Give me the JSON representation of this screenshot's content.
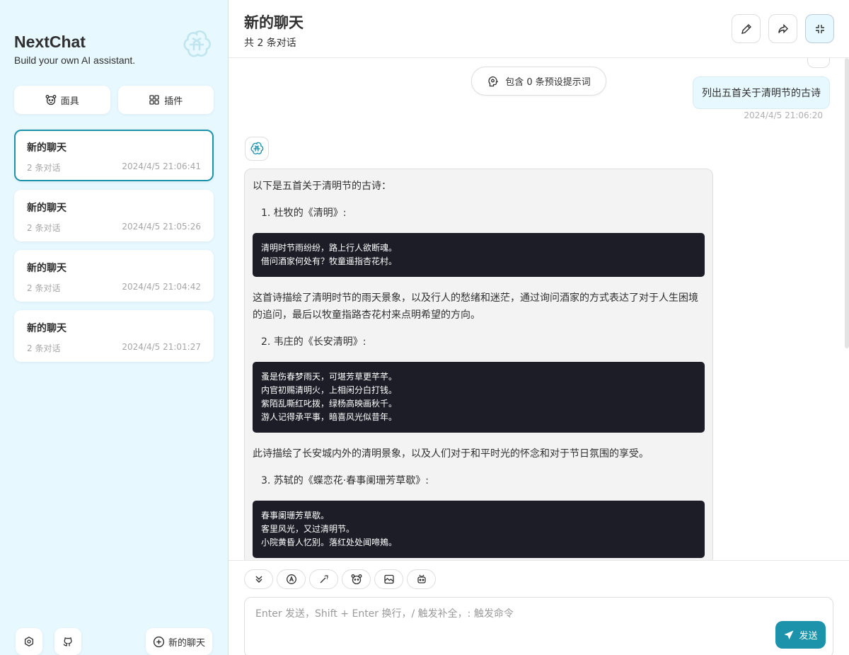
{
  "sidebar": {
    "title": "NextChat",
    "subtitle": "Build your own AI assistant.",
    "mask_label": "面具",
    "plugin_label": "插件",
    "chats": [
      {
        "title": "新的聊天",
        "count": "2 条对话",
        "date": "2024/4/5 21:06:41",
        "selected": true
      },
      {
        "title": "新的聊天",
        "count": "2 条对话",
        "date": "2024/4/5 21:05:26"
      },
      {
        "title": "新的聊天",
        "count": "2 条对话",
        "date": "2024/4/5 21:04:42"
      },
      {
        "title": "新的聊天",
        "count": "2 条对话",
        "date": "2024/4/5 21:01:27"
      }
    ],
    "new_chat_label": "新的聊天"
  },
  "header": {
    "title": "新的聊天",
    "subtitle": "共 2 条对话"
  },
  "chat": {
    "prompt_pill": "包含 0 条预设提示词",
    "user_message": "列出五首关于清明节的古诗",
    "user_date": "2024/4/5 21:06:20",
    "bot": {
      "intro": "以下是五首关于清明节的古诗：",
      "item1": "1. 杜牧的《清明》:",
      "code1": "清明时节雨纷纷，路上行人欲断魂。\n借问酒家何处有？牧童遥指杏花村。",
      "desc1": "这首诗描绘了清明时节的雨天景象，以及行人的愁绪和迷茫，通过询问酒家的方式表达了对于人生困境的追问，最后以牧童指路杏花村来点明希望的方向。",
      "item2": "2. 韦庄的《长安清明》:",
      "code2": "蚤是伤春梦雨天，可堪芳草更芊芊。\n内官初赐清明火，上相闲分白打钱。\n紫陌乱嘶红叱拨，绿杨高映画秋千。\n游人记得承平事，暗喜风光似昔年。",
      "desc2": "此诗描绘了长安城内外的清明景象，以及人们对于和平时光的怀念和对于节日氛围的享受。",
      "item3": "3. 苏轼的《蝶恋花·春事阑珊芳草歇》:",
      "code3": "春事阑珊芳草歇。\n客里风光，又过清明节。\n小院黄昏人忆别。落红处处闻啼鴂。"
    }
  },
  "input": {
    "placeholder": "Enter 发送，Shift + Enter 换行，/ 触发补全，: 触发命令",
    "send_label": "发送"
  },
  "colors": {
    "accent": "#1d93ab",
    "sidebar_bg": "#e7f8ff",
    "code_bg": "#1c1d27"
  }
}
